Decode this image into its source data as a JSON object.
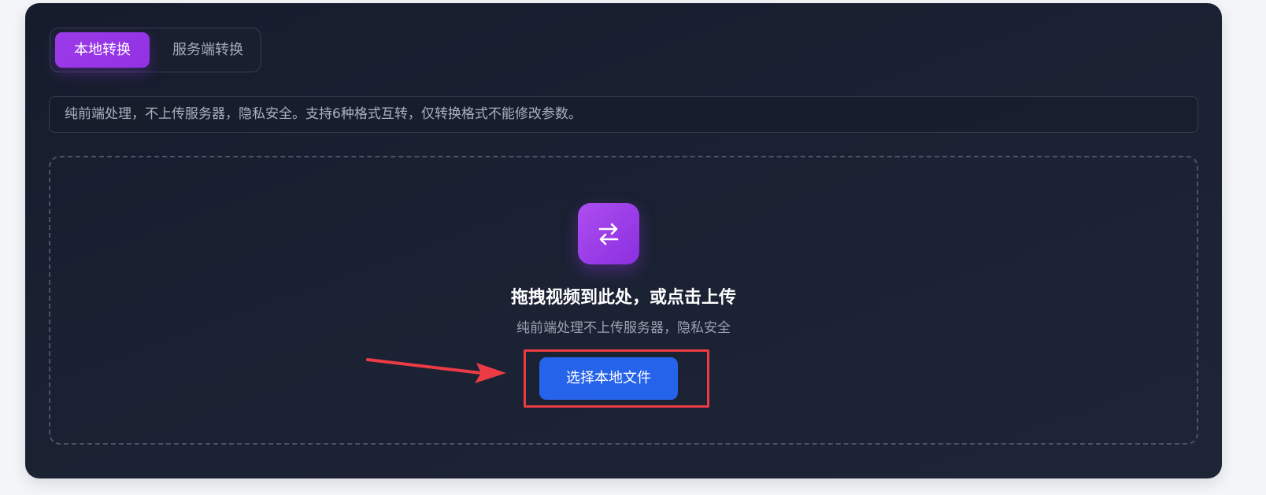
{
  "mode_tabs": {
    "local": "本地转换",
    "server": "服务端转换",
    "active": "local"
  },
  "notice": {
    "text": "纯前端处理，不上传服务器，隐私安全。支持6种格式互转，仅转换格式不能修改参数。"
  },
  "dropzone": {
    "icon": "swap-arrows-icon",
    "title": "拖拽视频到此处，或点击上传",
    "subtitle": "纯前端处理不上传服务器，隐私安全",
    "button_label": "选择本地文件"
  },
  "annotation": {
    "highlight_color": "#ec3b45",
    "arrow_color": "#ec3b45"
  },
  "colors": {
    "accent_purple": "#9333ea",
    "button_blue": "#2563eb",
    "card_background": "#1b2233"
  }
}
